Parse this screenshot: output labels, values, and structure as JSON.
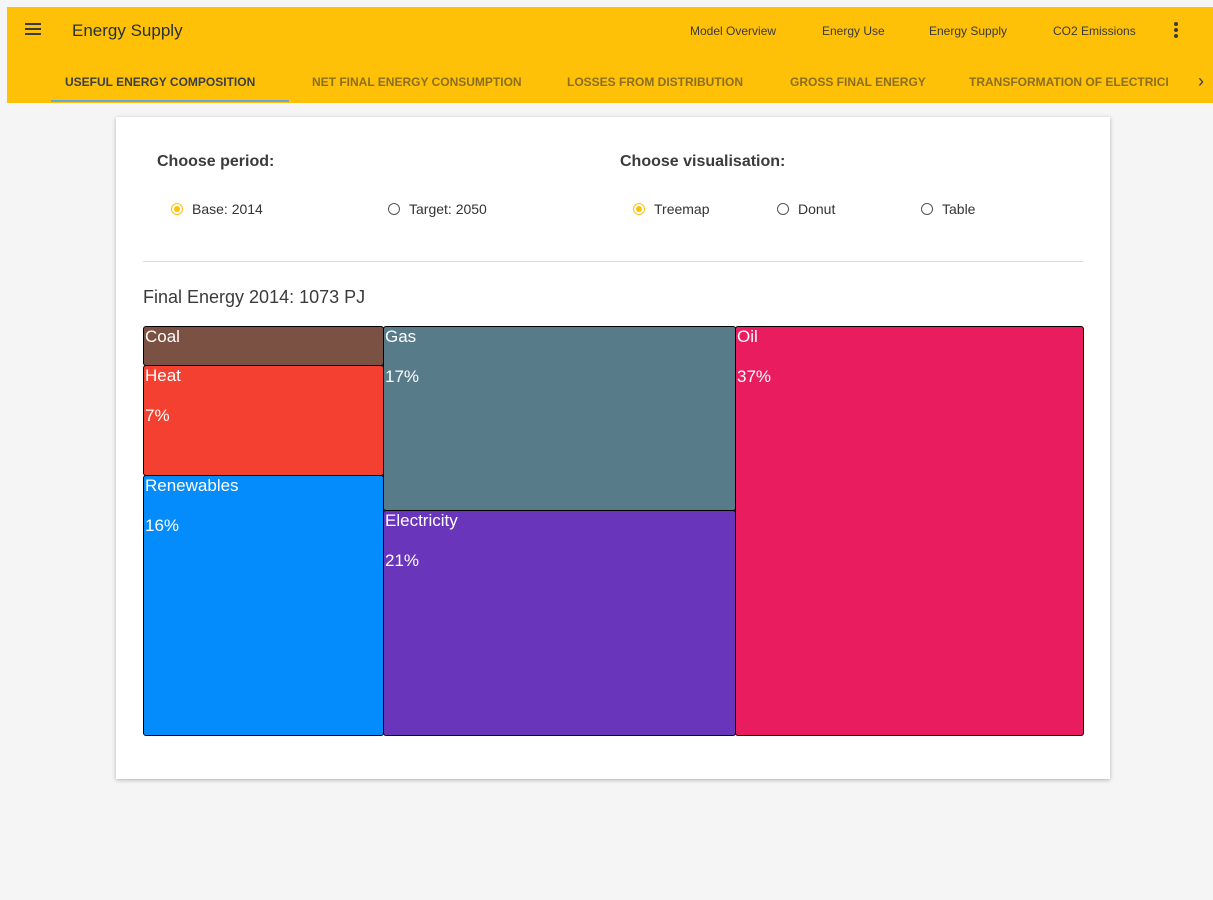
{
  "appbar": {
    "title": "Energy Supply",
    "links": [
      "Model Overview",
      "Energy Use",
      "Energy Supply",
      "CO2 Emissions"
    ]
  },
  "tabs": [
    "USEFUL ENERGY COMPOSITION",
    "NET FINAL ENERGY CONSUMPTION",
    "LOSSES FROM DISTRIBUTION",
    "GROSS FINAL ENERGY",
    "TRANSFORMATION OF ELECTRICI"
  ],
  "active_tab": 0,
  "period": {
    "heading": "Choose period:",
    "options": [
      "Base: 2014",
      "Target: 2050"
    ],
    "selected": 0
  },
  "visualisation": {
    "heading": "Choose visualisation:",
    "options": [
      "Treemap",
      "Donut",
      "Table"
    ],
    "selected": 0
  },
  "chart_data": {
    "type": "treemap",
    "title": "Final Energy 2014: 1073 PJ",
    "tiles": [
      {
        "name": "Coal",
        "value": null,
        "label": "",
        "color": "#7b5143"
      },
      {
        "name": "Heat",
        "value": 7,
        "label": "7%",
        "color": "#f44030"
      },
      {
        "name": "Renewables",
        "value": 16,
        "label": "16%",
        "color": "#048bfc"
      },
      {
        "name": "Gas",
        "value": 17,
        "label": "17%",
        "color": "#587b8a"
      },
      {
        "name": "Electricity",
        "value": 21,
        "label": "21%",
        "color": "#6935ba"
      },
      {
        "name": "Oil",
        "value": 37,
        "label": "37%",
        "color": "#ea1c60"
      }
    ]
  }
}
